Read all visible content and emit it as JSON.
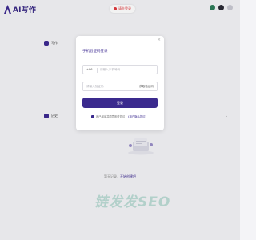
{
  "app": {
    "logo_text": "AI写作"
  },
  "top_notice": {
    "text": "请先登录"
  },
  "sidebar": {
    "items": [
      {
        "label": "写作"
      },
      {
        "label": "历史"
      }
    ]
  },
  "empty_state": {
    "text": "暂无记录，",
    "link": "开始创建吧"
  },
  "watermark": {
    "text": "链发发SEO"
  },
  "login_modal": {
    "title": "手机验证码登录",
    "close": "×",
    "phone_prefix": "+86",
    "phone_placeholder": "请输入手机号码",
    "code_placeholder": "请输入验证码",
    "code_button": "获取验证码",
    "login_button": "登录",
    "agree_text": "我已阅读并同意相关协议",
    "agree_link": "《用户隐私协议》"
  },
  "colors": {
    "primary": "#3b2a8e",
    "alert": "#e0393e"
  }
}
